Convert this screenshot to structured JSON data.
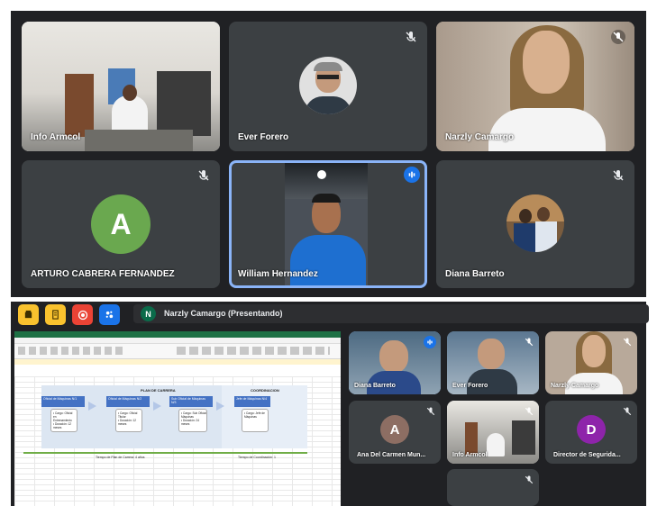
{
  "top_grid": {
    "tiles": [
      {
        "name": "Info Armcol",
        "muted": false
      },
      {
        "name": "Ever Forero",
        "muted": true
      },
      {
        "name": "Narzly Camargo",
        "muted": true
      },
      {
        "name": "ARTURO CABRERA FERNANDEZ",
        "muted": true,
        "avatar_letter": "A",
        "avatar_color": "#6aa84f"
      },
      {
        "name": "William Hernandez",
        "speaking": true
      },
      {
        "name": "Diana Barreto",
        "muted": true
      }
    ]
  },
  "toolbar": {
    "buttons": [
      "hand-icon",
      "notes-icon",
      "record-icon",
      "effects-icon"
    ],
    "presenter_initial": "N",
    "presenter_text": "Narzly Camargo (Presentando)"
  },
  "spreadsheet": {
    "plan_label": "PLAN DE CARRERA",
    "coord_label": "COORDINACION",
    "boxes": [
      {
        "title": "Oficial de Máquinas N/1",
        "body": "• Cargo: Oficial\nen\nEntrenamiento\n• Duración: 12\nmeses"
      },
      {
        "title": "Oficial de Máquinas N/2",
        "body": "• Cargo: Oficial\nTitular\n• Duración: 12\nmeses"
      },
      {
        "title": "Sub Oficial de Máquinas N/3",
        "body": "• Cargo: Sub Oficial\nMáquinas\n• Duración: 24\nmeses"
      },
      {
        "title": "Jefe de Máquinas N/4",
        "body": "• Cargo: Jefe de\nMáquinas"
      }
    ],
    "footer_left": "Tiempo de Plan de Carrera: 4 años",
    "footer_right": "Tiempo de Coordinación: 1"
  },
  "side_tiles": [
    {
      "name": "Diana Barreto"
    },
    {
      "name": "Ever Forero"
    },
    {
      "name": "Narzly Camargo"
    },
    {
      "name": "Ana Del Carmen Mun...",
      "avatar_letter": "A",
      "avatar_color": "#8d6e63"
    },
    {
      "name": "Info Armcol"
    },
    {
      "name": "Director de Segurida...",
      "avatar_letter": "D",
      "avatar_color": "#8e24aa"
    }
  ]
}
